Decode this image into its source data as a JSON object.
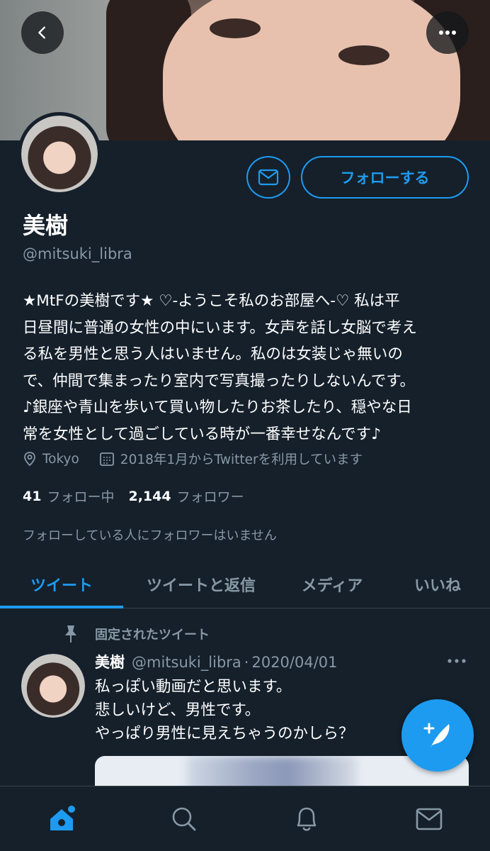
{
  "header": {
    "back_icon": "chevron-left-icon",
    "more_icon": "more-horizontal-icon"
  },
  "profile": {
    "name": "美樹",
    "handle": "@mitsuki_libra",
    "follow_label": "フォローする",
    "bio_lines": [
      "★MtFの美樹です★ ♡-ようこそ私のお部屋へ-♡ 私は平",
      "日昼間に普通の女性の中にいます。女声を話し女脳で考え",
      "る私を男性と思う人はいません。私のは女装じゃ無いの",
      "で、仲間で集まったり室内で写真撮ったりしないんです。",
      "♪銀座や青山を歩いて買い物したりお茶したり、穏やな日",
      "常を女性として過ごしている時が一番幸せなんです♪"
    ],
    "location": "Tokyo",
    "joined": "2018年1月からTwitterを利用しています",
    "following_count": "41",
    "following_label": "フォロー中",
    "followers_count": "2,144",
    "followers_label": "フォロワー",
    "no_mutual_text": "フォローしている人にフォロワーはいません"
  },
  "tabs": [
    {
      "label": "ツイート",
      "active": true
    },
    {
      "label": "ツイートと返信",
      "active": false
    },
    {
      "label": "メディア",
      "active": false
    },
    {
      "label": "いいね",
      "active": false
    }
  ],
  "pinned_tweet": {
    "pinned_label": "固定されたツイート",
    "author_name": "美樹",
    "author_handle": "@mitsuki_libra",
    "separator": "·",
    "date": "2020/04/01",
    "lines": [
      "私っぽい動画だと思います。",
      "悲しいけど、男性です。",
      "やっぱり男性に見えちゃうのかしら？"
    ]
  },
  "bottom_nav": [
    {
      "icon": "home-icon",
      "active": true
    },
    {
      "icon": "search-icon",
      "active": false
    },
    {
      "icon": "bell-icon",
      "active": false
    },
    {
      "icon": "mail-icon",
      "active": false
    }
  ],
  "colors": {
    "background": "#15202b",
    "accent": "#1d9bf0",
    "secondary_text": "#8899a6",
    "divider": "#38444d"
  }
}
